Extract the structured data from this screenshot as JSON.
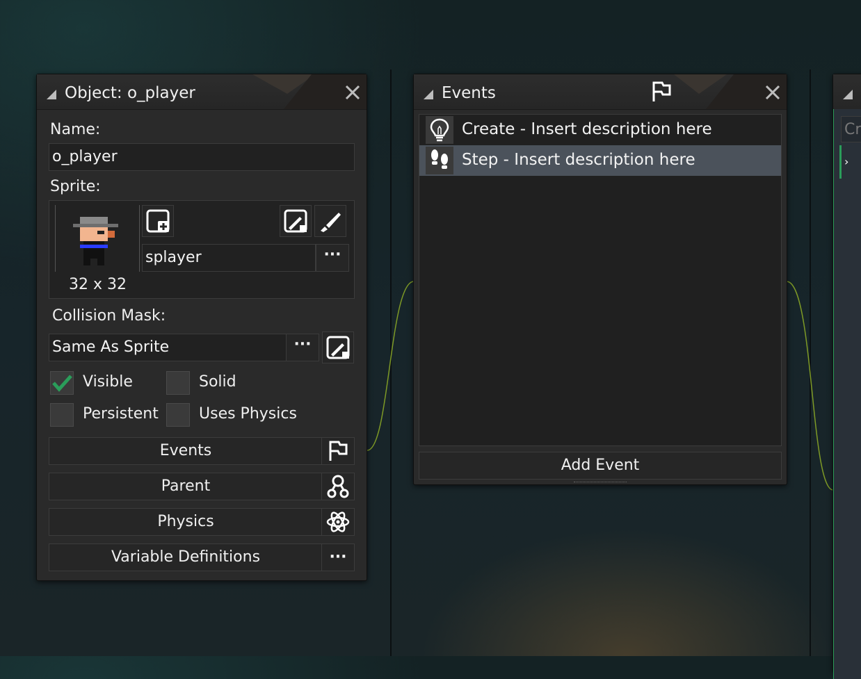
{
  "object_panel": {
    "title": "Object: o_player",
    "name_label": "Name:",
    "name_value": "o_player",
    "sprite_label": "Sprite:",
    "sprite_size": "32 x 32",
    "sprite_name": "splayer",
    "collision_label": "Collision Mask:",
    "collision_value": "Same As Sprite",
    "more_glyph": "···",
    "checkboxes": [
      {
        "label": "Visible",
        "checked": true
      },
      {
        "label": "Solid",
        "checked": false
      },
      {
        "label": "Persistent",
        "checked": false
      },
      {
        "label": "Uses Physics",
        "checked": false
      }
    ],
    "buttons": {
      "events": "Events",
      "parent": "Parent",
      "physics": "Physics",
      "variables": "Variable Definitions"
    }
  },
  "events_panel": {
    "title": "Events",
    "items": [
      {
        "label": "Create - Insert description here",
        "icon": "lightbulb-icon",
        "selected": false
      },
      {
        "label": "Step - Insert description here",
        "icon": "footsteps-icon",
        "selected": true
      }
    ],
    "add_button": "Add Event"
  },
  "right_panel": {
    "input_placeholder": "Cr"
  },
  "colors": {
    "accent_green": "#2a9d5a",
    "selection": "#4b525b",
    "panel_bg": "#2a2a2a",
    "wire": "#8aa82c"
  }
}
